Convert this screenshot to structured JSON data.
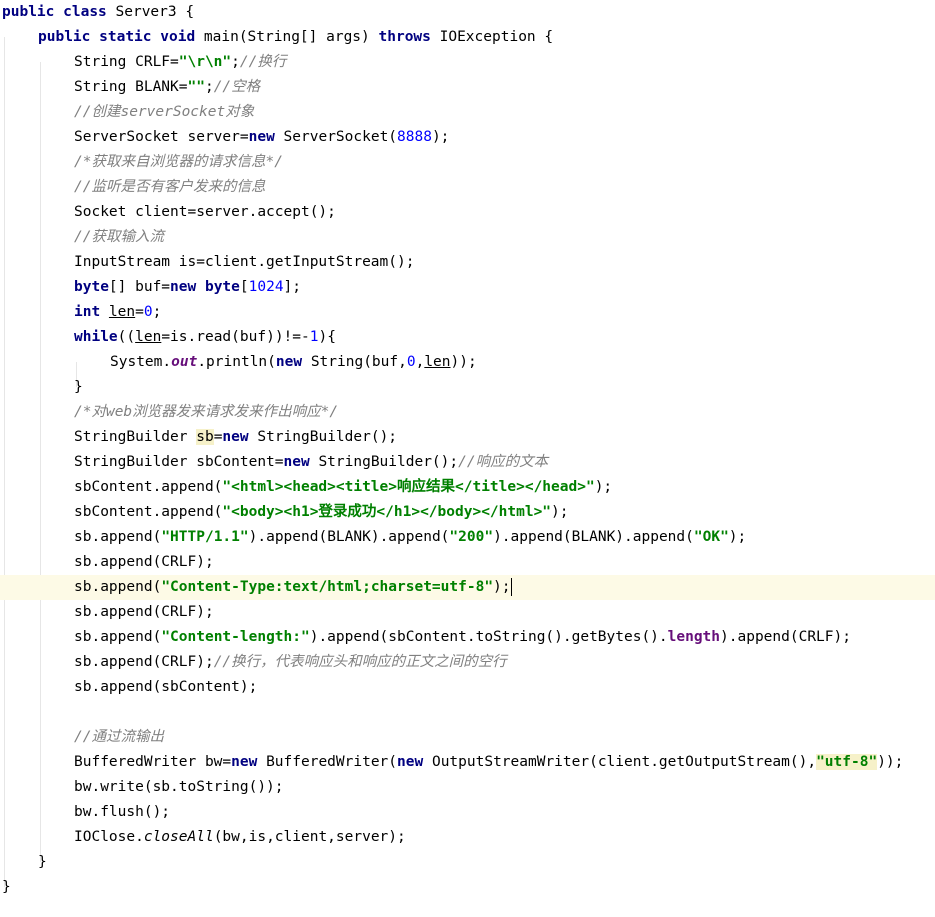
{
  "lines": [
    {
      "indent": 0,
      "tokens": [
        {
          "t": "public",
          "c": "kw"
        },
        {
          "t": " "
        },
        {
          "t": "class",
          "c": "kw"
        },
        {
          "t": " Server3 {"
        }
      ]
    },
    {
      "indent": 1,
      "tokens": [
        {
          "t": "public",
          "c": "kw"
        },
        {
          "t": " "
        },
        {
          "t": "static",
          "c": "kw"
        },
        {
          "t": " "
        },
        {
          "t": "void",
          "c": "kw"
        },
        {
          "t": " main(String[] args) "
        },
        {
          "t": "throws",
          "c": "kw"
        },
        {
          "t": " IOException {"
        }
      ]
    },
    {
      "indent": 2,
      "tokens": [
        {
          "t": "String CRLF="
        },
        {
          "t": "\"\\r\\n\"",
          "c": "str"
        },
        {
          "t": ";"
        },
        {
          "t": "//换行",
          "c": "com"
        }
      ]
    },
    {
      "indent": 2,
      "tokens": [
        {
          "t": "String BLANK="
        },
        {
          "t": "\"\"",
          "c": "str"
        },
        {
          "t": ";"
        },
        {
          "t": "//空格",
          "c": "com"
        }
      ]
    },
    {
      "indent": 2,
      "tokens": [
        {
          "t": "//创建serverSocket对象",
          "c": "com"
        }
      ]
    },
    {
      "indent": 2,
      "tokens": [
        {
          "t": "ServerSocket server="
        },
        {
          "t": "new",
          "c": "kw"
        },
        {
          "t": " ServerSocket("
        },
        {
          "t": "8888",
          "c": "num"
        },
        {
          "t": ");"
        }
      ]
    },
    {
      "indent": 2,
      "tokens": [
        {
          "t": "/*获取来自浏览器的请求信息*/",
          "c": "com"
        }
      ]
    },
    {
      "indent": 2,
      "tokens": [
        {
          "t": "//监听是否有客户发来的信息",
          "c": "com"
        }
      ]
    },
    {
      "indent": 2,
      "tokens": [
        {
          "t": "Socket client=server.accept();"
        }
      ]
    },
    {
      "indent": 2,
      "tokens": [
        {
          "t": "//获取输入流",
          "c": "com"
        }
      ]
    },
    {
      "indent": 2,
      "tokens": [
        {
          "t": "InputStream is=client.getInputStream();"
        }
      ]
    },
    {
      "indent": 2,
      "tokens": [
        {
          "t": "byte",
          "c": "kw"
        },
        {
          "t": "[] buf="
        },
        {
          "t": "new",
          "c": "kw"
        },
        {
          "t": " "
        },
        {
          "t": "byte",
          "c": "kw"
        },
        {
          "t": "["
        },
        {
          "t": "1024",
          "c": "num"
        },
        {
          "t": "];"
        }
      ]
    },
    {
      "indent": 2,
      "tokens": [
        {
          "t": "int",
          "c": "kw"
        },
        {
          "t": " "
        },
        {
          "t": "len",
          "c": "und"
        },
        {
          "t": "="
        },
        {
          "t": "0",
          "c": "num"
        },
        {
          "t": ";"
        }
      ]
    },
    {
      "indent": 2,
      "tokens": [
        {
          "t": "while",
          "c": "kw"
        },
        {
          "t": "(("
        },
        {
          "t": "len",
          "c": "und"
        },
        {
          "t": "=is.read(buf))!=-"
        },
        {
          "t": "1",
          "c": "num"
        },
        {
          "t": "){"
        }
      ]
    },
    {
      "indent": 3,
      "tokens": [
        {
          "t": "System."
        },
        {
          "t": "out",
          "c": "fld"
        },
        {
          "t": ".println("
        },
        {
          "t": "new",
          "c": "kw"
        },
        {
          "t": " String(buf,"
        },
        {
          "t": "0",
          "c": "num"
        },
        {
          "t": ","
        },
        {
          "t": "len",
          "c": "und"
        },
        {
          "t": "));"
        }
      ]
    },
    {
      "indent": 2,
      "tokens": [
        {
          "t": "}"
        }
      ]
    },
    {
      "indent": 2,
      "tokens": [
        {
          "t": "/*对web浏览器发来请求发来作出响应*/",
          "c": "com"
        }
      ]
    },
    {
      "indent": 2,
      "tokens": [
        {
          "t": "StringBuilder "
        },
        {
          "t": "sb",
          "c": "hl"
        },
        {
          "t": "="
        },
        {
          "t": "new",
          "c": "kw"
        },
        {
          "t": " StringBuilder();"
        }
      ]
    },
    {
      "indent": 2,
      "tokens": [
        {
          "t": "StringBuilder sbContent="
        },
        {
          "t": "new",
          "c": "kw"
        },
        {
          "t": " StringBuilder();"
        },
        {
          "t": "//响应的文本",
          "c": "com"
        }
      ]
    },
    {
      "indent": 2,
      "tokens": [
        {
          "t": "sbContent.append("
        },
        {
          "t": "\"<html><head><title>响应结果</title></head>\"",
          "c": "str"
        },
        {
          "t": ");"
        }
      ]
    },
    {
      "indent": 2,
      "tokens": [
        {
          "t": "sbContent.append("
        },
        {
          "t": "\"<body><h1>登录成功</h1></body></html>\"",
          "c": "str"
        },
        {
          "t": ");"
        }
      ]
    },
    {
      "indent": 2,
      "tokens": [
        {
          "t": "sb.append("
        },
        {
          "t": "\"HTTP/1.1\"",
          "c": "str"
        },
        {
          "t": ").append(BLANK).append("
        },
        {
          "t": "\"200\"",
          "c": "str"
        },
        {
          "t": ").append(BLANK).append("
        },
        {
          "t": "\"OK\"",
          "c": "str"
        },
        {
          "t": ");"
        }
      ]
    },
    {
      "indent": 2,
      "tokens": [
        {
          "t": "sb.append(CRLF);"
        }
      ]
    },
    {
      "indent": 2,
      "current": true,
      "caret": true,
      "tokens": [
        {
          "t": "sb.append("
        },
        {
          "t": "\"Content-Type:text/html;charset=utf-8\"",
          "c": "str"
        },
        {
          "t": ");"
        }
      ]
    },
    {
      "indent": 2,
      "tokens": [
        {
          "t": "sb.append(CRLF);"
        }
      ]
    },
    {
      "indent": 2,
      "tokens": [
        {
          "t": "sb.append("
        },
        {
          "t": "\"Content-length:\"",
          "c": "str"
        },
        {
          "t": ").append(sbContent.toString().getBytes()."
        },
        {
          "t": "length",
          "c": "fldb"
        },
        {
          "t": ").append(CRLF);"
        }
      ]
    },
    {
      "indent": 2,
      "tokens": [
        {
          "t": "sb.append(CRLF);"
        },
        {
          "t": "//换行，代表响应头和响应的正文之间的空行",
          "c": "com"
        }
      ]
    },
    {
      "indent": 2,
      "tokens": [
        {
          "t": "sb.append(sbContent);"
        }
      ]
    },
    {
      "indent": 2,
      "tokens": []
    },
    {
      "indent": 2,
      "tokens": [
        {
          "t": "//通过流输出",
          "c": "com"
        }
      ]
    },
    {
      "indent": 2,
      "tokens": [
        {
          "t": "BufferedWriter bw="
        },
        {
          "t": "new",
          "c": "kw"
        },
        {
          "t": " BufferedWriter("
        },
        {
          "t": "new",
          "c": "kw"
        },
        {
          "t": " OutputStreamWriter(client.getOutputStream(),"
        },
        {
          "t": "\"utf-8\"",
          "c": "str hl"
        },
        {
          "t": "));"
        }
      ]
    },
    {
      "indent": 2,
      "tokens": [
        {
          "t": "bw.write(sb.toString());"
        }
      ]
    },
    {
      "indent": 2,
      "tokens": [
        {
          "t": "bw.flush();"
        }
      ]
    },
    {
      "indent": 2,
      "tokens": [
        {
          "t": "IOClose."
        },
        {
          "t": "closeAll",
          "c": "sm"
        },
        {
          "t": "(bw,is,client,server);"
        }
      ]
    },
    {
      "indent": 1,
      "tokens": [
        {
          "t": "}"
        }
      ]
    },
    {
      "indent": 0,
      "tokens": [
        {
          "t": "}"
        }
      ]
    }
  ]
}
